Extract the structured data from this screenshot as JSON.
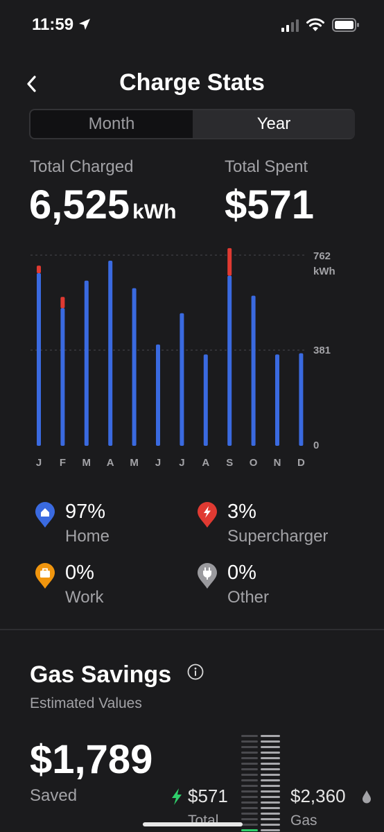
{
  "status_bar": {
    "time": "11:59",
    "icons": [
      "location-arrow-icon",
      "cellular-signal-icon",
      "wifi-icon",
      "battery-icon"
    ]
  },
  "header": {
    "title": "Charge Stats",
    "back_icon": "chevron-left-icon"
  },
  "period_tabs": [
    {
      "label": "Month",
      "selected": false
    },
    {
      "label": "Year",
      "selected": true
    }
  ],
  "summary": {
    "total_charged_label": "Total Charged",
    "total_charged_value": "6,525",
    "total_charged_unit": "kWh",
    "total_spent_label": "Total Spent",
    "total_spent_value": "$571"
  },
  "colors": {
    "home": "#3a6ae0",
    "supercharger": "#e03a32",
    "work": "#f0950e",
    "other": "#9a9a9e",
    "background": "#1b1b1d",
    "saved_green": "#2fcf6b"
  },
  "chart_data": {
    "type": "bar",
    "stacked": true,
    "categories": [
      "J",
      "F",
      "M",
      "A",
      "M",
      "J",
      "J",
      "A",
      "S",
      "O",
      "N",
      "D"
    ],
    "series": [
      {
        "color": "#3a6ae0",
        "values": [
          690,
          550,
          660,
          740,
          630,
          405,
          530,
          365,
          680,
          600,
          365,
          370
        ]
      },
      {
        "color": "#e03a32",
        "values": [
          30,
          45,
          0,
          0,
          0,
          0,
          0,
          0,
          110,
          0,
          0,
          0
        ]
      }
    ],
    "ylim": [
      0,
      762
    ],
    "y_ticks": [
      "0",
      "381",
      "762"
    ],
    "y_unit": "kWh",
    "grid": true
  },
  "legend": [
    {
      "percent": "97%",
      "name": "Home",
      "icon": "home-pin-icon"
    },
    {
      "percent": "3%",
      "name": "Supercharger",
      "icon": "supercharger-pin-icon"
    },
    {
      "percent": "0%",
      "name": "Work",
      "icon": "work-pin-icon"
    },
    {
      "percent": "0%",
      "name": "Other",
      "icon": "other-plug-pin-icon"
    }
  ],
  "gas_savings": {
    "title": "Gas Savings",
    "subtitle": "Estimated Values",
    "saved_value": "$1,789",
    "saved_label": "Saved",
    "total_value": "$571",
    "total_label": "Total",
    "gas_value": "$2,360",
    "gas_label": "Gas"
  }
}
